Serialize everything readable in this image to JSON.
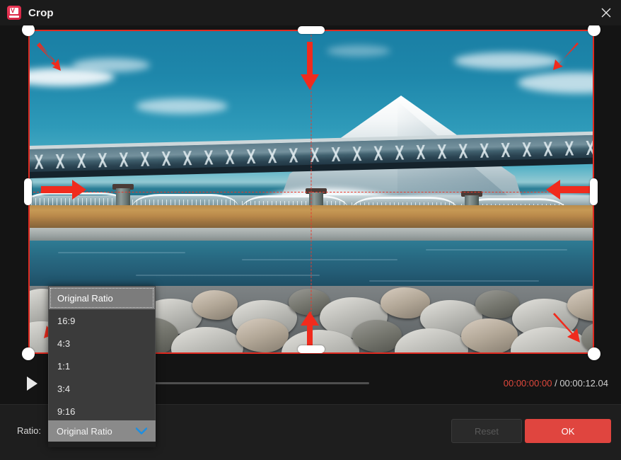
{
  "window": {
    "title": "Crop",
    "app_icon": "app-logo-icon",
    "close_icon": "close-icon"
  },
  "preview": {
    "image_description": "Mount Fuji with snow cap behind a steel truss railway bridge over a river with a rocky shore",
    "crop_border_color": "#e02a20",
    "guide_color": "#e8392c",
    "handles": [
      {
        "name": "handle-top-left",
        "type": "corner"
      },
      {
        "name": "handle-top-center",
        "type": "h-edge"
      },
      {
        "name": "handle-top-right",
        "type": "corner"
      },
      {
        "name": "handle-middle-left",
        "type": "v-edge"
      },
      {
        "name": "handle-middle-right",
        "type": "v-edge"
      },
      {
        "name": "handle-bottom-left",
        "type": "corner"
      },
      {
        "name": "handle-bottom-center",
        "type": "h-edge"
      },
      {
        "name": "handle-bottom-right",
        "type": "corner"
      }
    ],
    "annotation_arrows": 8,
    "annotation_color": "#f02b1d"
  },
  "transport": {
    "play_icon": "play-icon",
    "current_time": "00:00:00:00",
    "separator": "/",
    "total_time": "00:00:12.04",
    "current_time_color": "#e0483c",
    "progress_percent": 0
  },
  "footer": {
    "ratio_label": "Ratio:",
    "ratio_selected": "Original Ratio",
    "chevron_icon": "chevron-down-icon",
    "chevron_color": "#1f8fe0",
    "reset_label": "Reset",
    "reset_disabled": true,
    "ok_label": "OK",
    "ok_color": "#e0453f"
  },
  "dropdown": {
    "open": true,
    "options": [
      "Original Ratio",
      "16:9",
      "4:3",
      "1:1",
      "3:4",
      "9:16"
    ],
    "highlighted_index": 0
  }
}
